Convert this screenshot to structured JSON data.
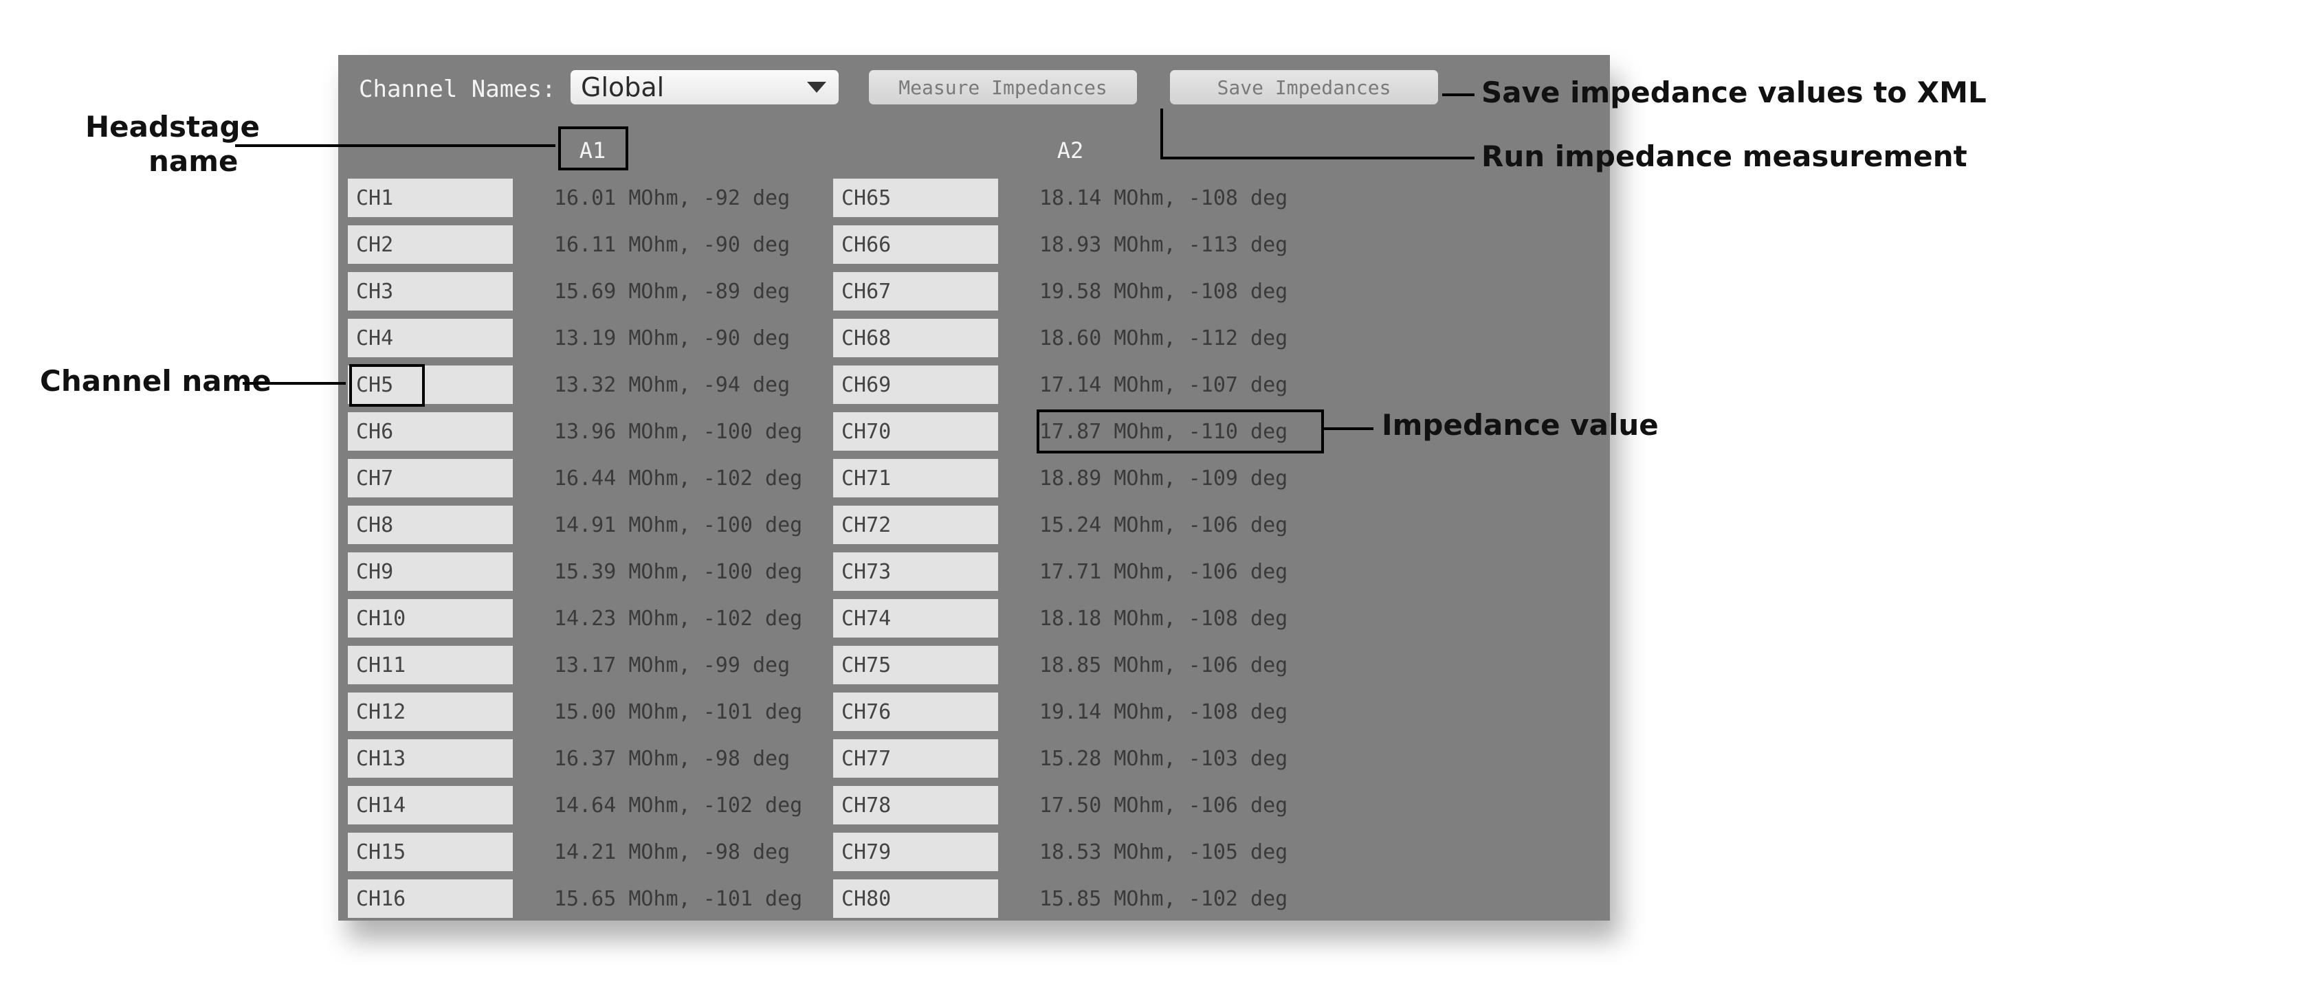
{
  "toolbar": {
    "label": "Channel Names:",
    "select_value": "Global",
    "measure_label": "Measure Impedances",
    "save_label": "Save Impedances"
  },
  "headstages": {
    "a1": "A1",
    "a2": "A2"
  },
  "columns": {
    "a": [
      {
        "ch": "CH1",
        "val": "16.01 MOhm, -92 deg"
      },
      {
        "ch": "CH2",
        "val": "16.11 MOhm, -90 deg"
      },
      {
        "ch": "CH3",
        "val": "15.69 MOhm, -89 deg"
      },
      {
        "ch": "CH4",
        "val": "13.19 MOhm, -90 deg"
      },
      {
        "ch": "CH5",
        "val": "13.32 MOhm, -94 deg"
      },
      {
        "ch": "CH6",
        "val": "13.96 MOhm, -100 deg"
      },
      {
        "ch": "CH7",
        "val": "16.44 MOhm, -102 deg"
      },
      {
        "ch": "CH8",
        "val": "14.91 MOhm, -100 deg"
      },
      {
        "ch": "CH9",
        "val": "15.39 MOhm, -100 deg"
      },
      {
        "ch": "CH10",
        "val": "14.23 MOhm, -102 deg"
      },
      {
        "ch": "CH11",
        "val": "13.17 MOhm, -99 deg"
      },
      {
        "ch": "CH12",
        "val": "15.00 MOhm, -101 deg"
      },
      {
        "ch": "CH13",
        "val": "16.37 MOhm, -98 deg"
      },
      {
        "ch": "CH14",
        "val": "14.64 MOhm, -102 deg"
      },
      {
        "ch": "CH15",
        "val": "14.21 MOhm, -98 deg"
      },
      {
        "ch": "CH16",
        "val": "15.65 MOhm, -101 deg"
      }
    ],
    "b": [
      {
        "ch": "CH65",
        "val": "18.14 MOhm, -108 deg"
      },
      {
        "ch": "CH66",
        "val": "18.93 MOhm, -113 deg"
      },
      {
        "ch": "CH67",
        "val": "19.58 MOhm, -108 deg"
      },
      {
        "ch": "CH68",
        "val": "18.60 MOhm, -112 deg"
      },
      {
        "ch": "CH69",
        "val": "17.14 MOhm, -107 deg"
      },
      {
        "ch": "CH70",
        "val": "17.87 MOhm, -110 deg"
      },
      {
        "ch": "CH71",
        "val": "18.89 MOhm, -109 deg"
      },
      {
        "ch": "CH72",
        "val": "15.24 MOhm, -106 deg"
      },
      {
        "ch": "CH73",
        "val": "17.71 MOhm, -106 deg"
      },
      {
        "ch": "CH74",
        "val": "18.18 MOhm, -108 deg"
      },
      {
        "ch": "CH75",
        "val": "18.85 MOhm, -106 deg"
      },
      {
        "ch": "CH76",
        "val": "19.14 MOhm, -108 deg"
      },
      {
        "ch": "CH77",
        "val": "15.28 MOhm, -103 deg"
      },
      {
        "ch": "CH78",
        "val": "17.50 MOhm, -106 deg"
      },
      {
        "ch": "CH79",
        "val": "18.53 MOhm, -105 deg"
      },
      {
        "ch": "CH80",
        "val": "15.85 MOhm, -102 deg"
      }
    ]
  },
  "annotations": {
    "headstage_name_l1": "Headstage",
    "headstage_name_l2": "name",
    "channel_name": "Channel name",
    "save_desc": "Save impedance values to XML",
    "run_desc": "Run impedance measurement",
    "impedance_value": "Impedance value"
  }
}
